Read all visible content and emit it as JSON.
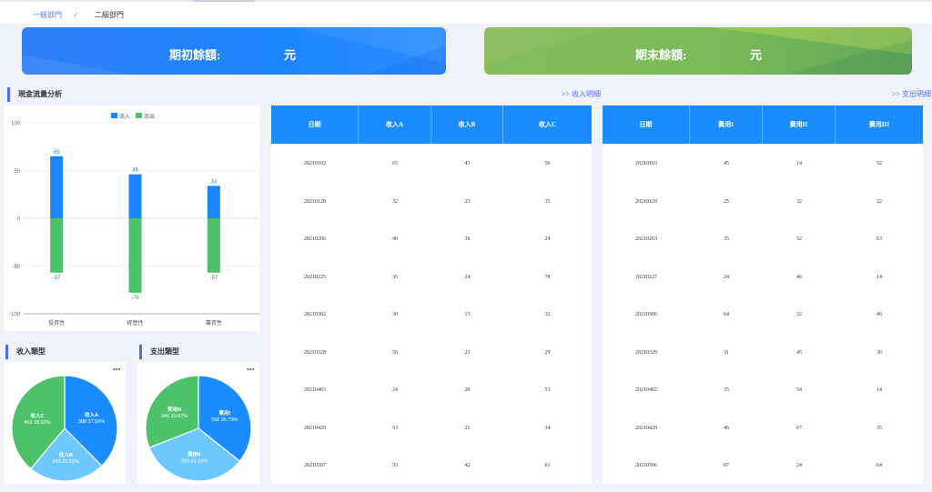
{
  "breadcrumb": {
    "level1": "一級部門",
    "separator": "/",
    "level2": "二級部門"
  },
  "banners": {
    "opening": {
      "label": "期初餘額:",
      "unit": "元",
      "color": "#1c86ff"
    },
    "closing": {
      "label": "期末餘額:",
      "unit": "元",
      "color": "#79b957"
    }
  },
  "cashflow": {
    "title": "現金流量分析",
    "legend": {
      "inflow": "流入",
      "outflow": "流出"
    },
    "colors": {
      "inflow": "#1c86ff",
      "outflow": "#4cc26a"
    }
  },
  "links": {
    "income_detail": ">> 收入明細",
    "expense_detail": ">> 支出明細"
  },
  "income_table": {
    "headers": [
      "日期",
      "收入A",
      "收入B",
      "收入C"
    ],
    "rows": [
      [
        "20210102",
        "65",
        "43",
        "56"
      ],
      [
        "20210128",
        "32",
        "23",
        "35"
      ],
      [
        "20210206",
        "40",
        "36",
        "24"
      ],
      [
        "20210225",
        "35",
        "24",
        "78"
      ],
      [
        "20210302",
        "30",
        "13",
        "32"
      ],
      [
        "20210328",
        "56",
        "21",
        "29"
      ],
      [
        "20210403",
        "24",
        "20",
        "53"
      ],
      [
        "20210429",
        "53",
        "21",
        "34"
      ],
      [
        "20210507",
        "53",
        "42",
        "61"
      ]
    ]
  },
  "expense_table": {
    "headers": [
      "日期",
      "費用I",
      "費用II",
      "費用III"
    ],
    "rows": [
      [
        "20210103",
        "45",
        "14",
        "52"
      ],
      [
        "20210129",
        "25",
        "32",
        "22"
      ],
      [
        "20210203",
        "35",
        "52",
        "63"
      ],
      [
        "20210227",
        "24",
        "46",
        "14"
      ],
      [
        "20210306",
        "64",
        "32",
        "46"
      ],
      [
        "20210329",
        "31",
        "45",
        "30"
      ],
      [
        "20210402",
        "35",
        "54",
        "14"
      ],
      [
        "20210429",
        "46",
        "67",
        "35"
      ],
      [
        "20210506",
        "87",
        "24",
        "64"
      ]
    ]
  },
  "income_type": {
    "title": "收入類型",
    "menu_icon": "ellipsis-icon"
  },
  "expense_type": {
    "title": "支出類型",
    "menu_icon": "ellipsis-icon"
  },
  "chart_data": [
    {
      "type": "bar",
      "categories": [
        "投資性",
        "經營性",
        "籌資性"
      ],
      "series": [
        {
          "name": "流入",
          "values": [
            65,
            46,
            34
          ]
        },
        {
          "name": "流出",
          "values": [
            -57,
            -78,
            -57
          ]
        }
      ],
      "ylim": [
        -100,
        100
      ],
      "yticks": [
        100,
        50,
        0,
        -50,
        -100
      ],
      "stacked": true,
      "grid": true,
      "legend": "top-center"
    },
    {
      "type": "pie",
      "slices": [
        {
          "label": "收入A",
          "value": 388,
          "percent": "37.56%",
          "color": "#1a8cff"
        },
        {
          "label": "收入B",
          "value": 243,
          "percent": "23.52%",
          "color": "#6dc8ff"
        },
        {
          "label": "收入C",
          "value": 402,
          "percent": "38.92%",
          "color": "#4cc26a"
        }
      ]
    },
    {
      "type": "pie",
      "slices": [
        {
          "label": "費用I",
          "value": 392,
          "percent": "35.70%",
          "color": "#1a8cff"
        },
        {
          "label": "費用II",
          "value": 366,
          "percent": "33.33%",
          "color": "#6dc8ff"
        },
        {
          "label": "費用III",
          "value": 340,
          "percent": "30.97%",
          "color": "#4cc26a"
        }
      ]
    }
  ]
}
